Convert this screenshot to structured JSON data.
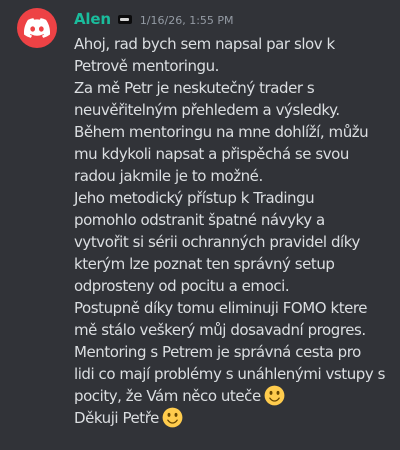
{
  "message": {
    "author": "Alen",
    "author_color": "#1abc9c",
    "avatar_icon": "discord-logo-icon",
    "avatar_color": "#ed4245",
    "guild_tag_icon": "guild-tag-icon",
    "timestamp": "1/16/26, 1:55 PM",
    "lines": [
      "Ahoj, rad bych sem napsal par slov k",
      "Petrově mentoringu.",
      "Za mě Petr je neskutečný trader s",
      "neuvěřitelným přehledem a výsledky.",
      "Během mentoringu na mne dohlíží, můžu",
      "mu kdykoli napsat a přispěchá se svou",
      "radou jakmile je to možné.",
      "Jeho metodický přístup k Tradingu",
      "pomohlo odstranit špatné návyky a",
      "vytvořit si sérii ochranných pravidel díky",
      "kterým lze poznat ten správný setup",
      "odprosteny od pocitu a emoci.",
      "Postupně díky tomu eliminuji FOMO ktere",
      "mě stálo veškerý můj dosavadní progres.",
      "Mentoring s Petrem je správná cesta pro",
      "lidi co mají problémy s unáhlenými vstupy s",
      "pocity, že Vám něco uteče",
      "Děkuji Petře"
    ],
    "emoji_icon": "slightly-smiling-face-emoji"
  }
}
